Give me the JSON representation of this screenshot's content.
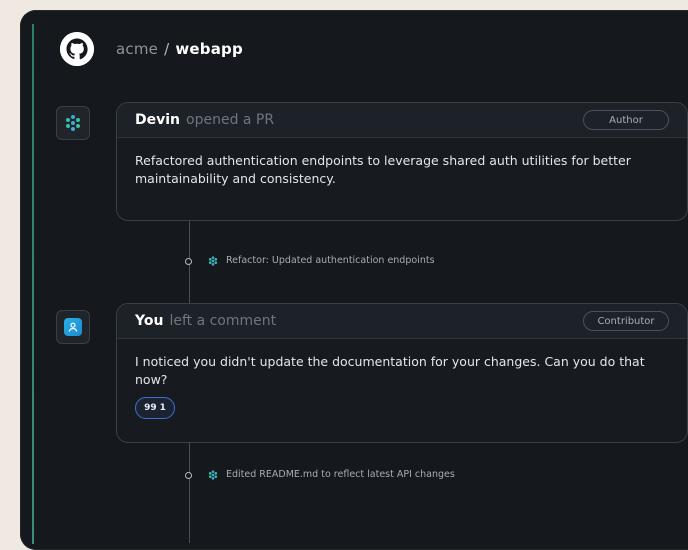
{
  "header": {
    "org": "acme",
    "separator": "/",
    "repo": "webapp"
  },
  "icons": {
    "logo": "github-icon",
    "devin_avatar": "devin-logo-icon",
    "user_avatar": "user-icon",
    "commit_marker": "devin-logo-icon",
    "reaction": "quote-icon"
  },
  "colors": {
    "background": "#efe9e1",
    "panel": "#15181d",
    "accent": "#2a8c78",
    "reaction_border": "#3f6fd0",
    "user_avatar": "#27b0e6",
    "devin_logo": "#3fa9d6"
  },
  "timeline": {
    "pr_card": {
      "author": "Devin",
      "action": "opened a PR",
      "role": "Author",
      "body": "Refactored authentication endpoints to leverage shared auth utilities for better maintainability and consistency."
    },
    "event_1": {
      "text": "Refactor: Updated authentication endpoints"
    },
    "comment_card": {
      "author": "You",
      "action": "left a comment",
      "role": "Contributor",
      "body": "I noticed you didn't update the documentation for your changes. Can you do that now?",
      "reaction_label": "99",
      "reaction_count": "1"
    },
    "event_2": {
      "text": "Edited README.md to reflect latest API changes"
    }
  }
}
